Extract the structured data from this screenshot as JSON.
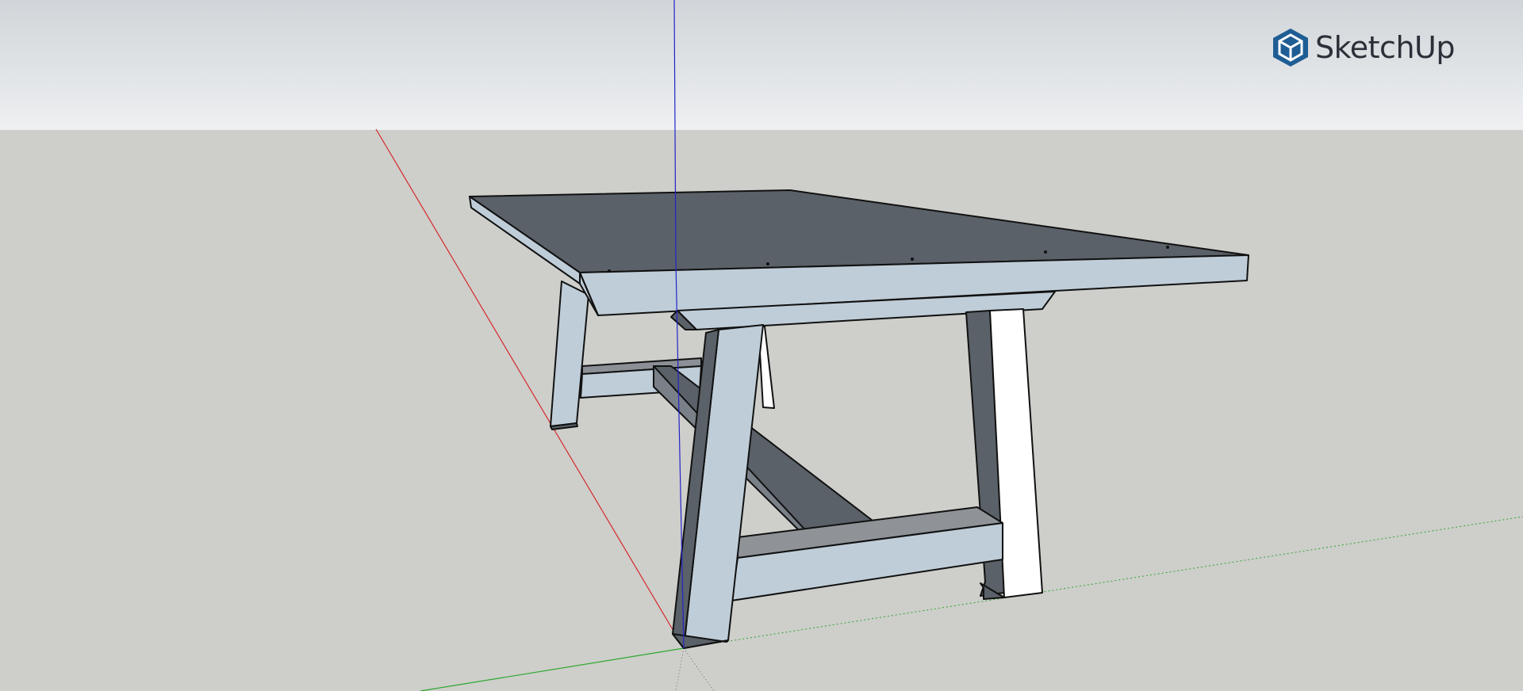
{
  "app": {
    "brand_name": "SketchUp",
    "brand_icon": "sketchup-logo-icon",
    "colors": {
      "brand": "#1f5e94",
      "x_axis": "#d42a2a",
      "y_axis": "#2ea82e",
      "z_axis": "#2323c8",
      "sky": "#e4e7ea",
      "ground": "#cececb",
      "face_front": "#bfcdd8",
      "face_back": "#5a6168",
      "face_lit": "#ffffff",
      "edge": "#111111"
    }
  },
  "viewport": {
    "model": "table",
    "parts": [
      "tabletop",
      "apron",
      "front-leg-left",
      "front-leg-right",
      "back-leg",
      "stretcher-front",
      "stretcher-back",
      "center-stretcher"
    ]
  }
}
